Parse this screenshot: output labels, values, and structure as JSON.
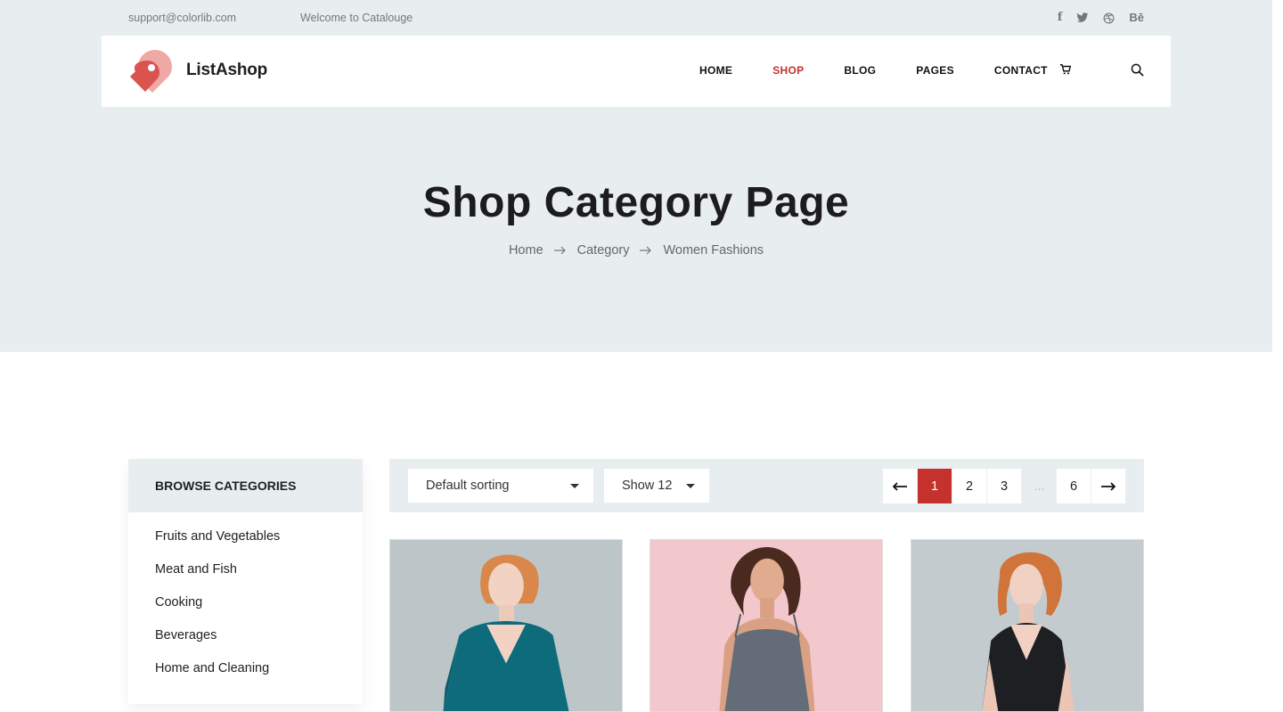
{
  "topbar": {
    "email": "support@colorlib.com",
    "welcome": "Welcome to Catalouge",
    "social_icons": [
      "facebook-icon",
      "twitter-icon",
      "dribbble-icon",
      "behance-icon"
    ]
  },
  "header": {
    "brand": "ListAshop",
    "nav": [
      {
        "label": "HOME",
        "active": false
      },
      {
        "label": "SHOP",
        "active": true
      },
      {
        "label": "BLOG",
        "active": false
      },
      {
        "label": "PAGES",
        "active": false
      },
      {
        "label": "CONTACT",
        "active": false
      }
    ],
    "icons": [
      "cart-icon",
      "search-icon"
    ]
  },
  "hero": {
    "title": "Shop Category Page",
    "breadcrumb": [
      "Home",
      "Category",
      "Women Fashions"
    ]
  },
  "sidebar": {
    "title": "BROWSE CATEGORIES",
    "items": [
      "Fruits and Vegetables",
      "Meat and Fish",
      "Cooking",
      "Beverages",
      "Home and Cleaning"
    ]
  },
  "toolbar": {
    "sorting": "Default sorting",
    "show": "Show 12",
    "pagination": {
      "pages": [
        "1",
        "2",
        "3",
        "...",
        "6"
      ],
      "current": "1"
    }
  },
  "colors": {
    "accent": "#c5322d",
    "light_bg": "#e8eef0"
  }
}
